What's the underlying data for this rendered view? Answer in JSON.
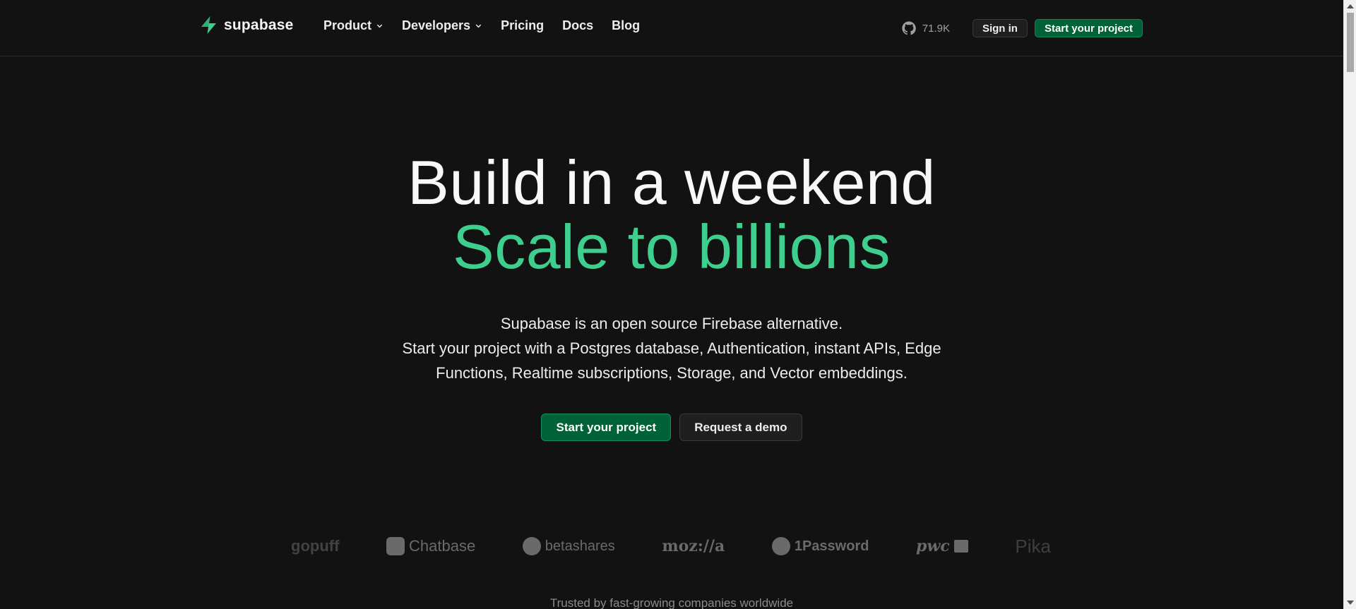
{
  "nav": {
    "logo_text": "supabase",
    "menu": [
      {
        "label": "Product",
        "has_dropdown": true
      },
      {
        "label": "Developers",
        "has_dropdown": true
      },
      {
        "label": "Pricing",
        "has_dropdown": false
      },
      {
        "label": "Docs",
        "has_dropdown": false
      },
      {
        "label": "Blog",
        "has_dropdown": false
      }
    ],
    "github_stars": "71.9K",
    "sign_in": "Sign in",
    "start_project": "Start your project"
  },
  "hero": {
    "title_line1": "Build in a weekend",
    "title_line2": "Scale to billions",
    "subtitle_line1": "Supabase is an open source Firebase alternative.",
    "subtitle_line2": "Start your project with a Postgres database, Authentication, instant APIs, Edge",
    "subtitle_line3": "Functions, Realtime subscriptions, Storage, and Vector embeddings.",
    "primary_cta": "Start your project",
    "secondary_cta": "Request a demo"
  },
  "logos": {
    "brands": [
      "gopuff",
      "Chatbase",
      "betashares",
      "moz://a",
      "1Password",
      "pwc",
      "Pika"
    ],
    "trusted_text": "Trusted by fast-growing companies worldwide"
  },
  "colors": {
    "background": "#121212",
    "brand_green": "#3ecf8e",
    "button_green": "#006239"
  }
}
